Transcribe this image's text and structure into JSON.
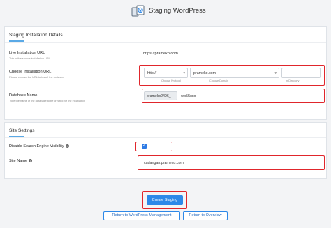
{
  "header": {
    "title": "Staging WordPress",
    "logo_icon": "staging-wordpress-icon"
  },
  "installation": {
    "section_title": "Staging Installation Details",
    "live_url": {
      "label": "Live Installation URL",
      "hint": "This is the source installation URL",
      "value": "https://prameko.com"
    },
    "choose_url": {
      "label": "Choose Installation URL",
      "hint": "Please choose the URL to install the software",
      "protocol": {
        "value": "http://",
        "caption": "Choose Protocol"
      },
      "domain": {
        "value": "prameko.com",
        "caption": "Choose Domain"
      },
      "directory": {
        "value": "",
        "caption": "In Directory"
      }
    },
    "database": {
      "label": "Database Name",
      "hint": "Type the name of the database to be created for the installation",
      "prefix": "prameko2496_",
      "value": "wp55xxx"
    }
  },
  "site_settings": {
    "section_title": "Site Settings",
    "search_visibility": {
      "label": "Disable Search Engine Visibility",
      "checked": true
    },
    "site_name": {
      "label": "Site Name",
      "value": "cadangan.prameko.com"
    }
  },
  "actions": {
    "create": "Create Staging",
    "return_wp": "Return to WordPress Management",
    "return_overview": "Return to Overview"
  },
  "colors": {
    "accent": "#2d88e8",
    "highlight": "#e0262c"
  }
}
